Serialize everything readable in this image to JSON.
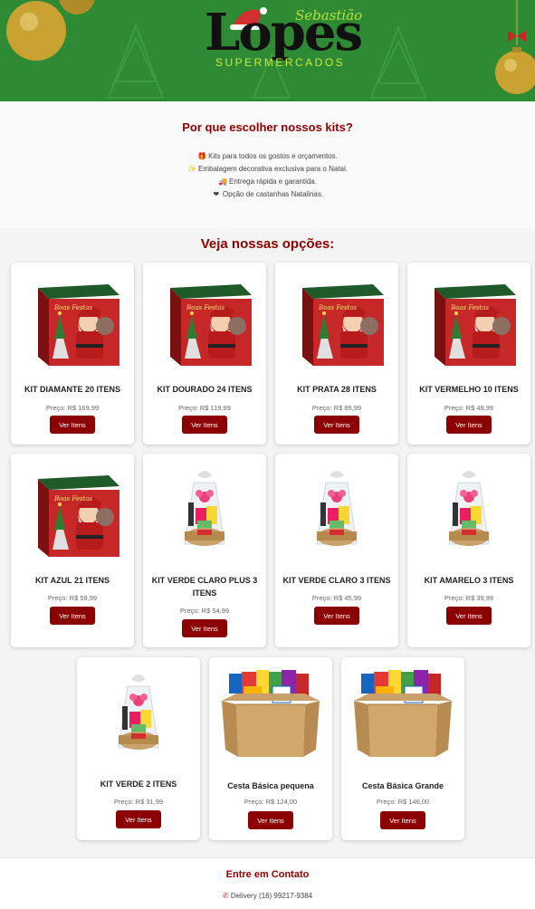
{
  "header": {
    "logo_script": "Sebastião",
    "logo_main": "Lopes",
    "logo_tagline": "SUPERMERCADOS"
  },
  "why": {
    "title": "Por que escolher nossos kits?",
    "items": [
      {
        "icon": "gift-icon",
        "glyph": "🎁",
        "text": "Kits para todos os gostos e orçamentos."
      },
      {
        "icon": "sparkles-icon",
        "glyph": "✨",
        "text": "Embalagem decorativa exclusiva para o Natal."
      },
      {
        "icon": "truck-icon",
        "glyph": "🚚",
        "text": "Entrega rápida e garantida."
      },
      {
        "icon": "heart-icon",
        "glyph": "❤",
        "text": "Opção de castanhas Natalinas."
      }
    ]
  },
  "options_title": "Veja nossas opções:",
  "products": [
    {
      "name": "KIT DIAMANTE 20 ITENS",
      "price": "Preço: R$ 169,99",
      "button": "Ver Itens",
      "image": "santa-box"
    },
    {
      "name": "KIT DOURADO 24 ITENS",
      "price": "Preço: R$ 119,99",
      "button": "Ver Itens",
      "image": "santa-box"
    },
    {
      "name": "KIT PRATA 28 ITENS",
      "price": "Preço: R$ 89,99",
      "button": "Ver Itens",
      "image": "santa-box"
    },
    {
      "name": "KIT VERMELHO 10 ITENS",
      "price": "Preço: R$ 49,99",
      "button": "Ver Itens",
      "image": "santa-box"
    },
    {
      "name": "KIT AZUL 21 ITENS",
      "price": "Preço: R$ 59,99",
      "button": "Ver Itens",
      "image": "santa-box"
    },
    {
      "name": "KIT VERDE CLARO PLUS 3 ITENS",
      "price": "Preço: R$ 54,99",
      "button": "Ver Itens",
      "image": "gift-basket"
    },
    {
      "name": "KIT VERDE CLARO 3 ITENS",
      "price": "Preço: R$ 45,99",
      "button": "Ver Itens",
      "image": "gift-basket"
    },
    {
      "name": "KIT AMARELO 3 ITENS",
      "price": "Preço: R$ 39,99",
      "button": "Ver Itens",
      "image": "gift-basket"
    },
    {
      "name": "KIT VERDE 2 ITENS",
      "price": "Preço: R$ 31,99",
      "button": "Ver Itens",
      "image": "gift-basket"
    },
    {
      "name": "Cesta Básica pequena",
      "price": "Preço: R$ 124,00",
      "button": "Ver Itens",
      "image": "grocery-box"
    },
    {
      "name": "Cesta Básica Grande",
      "price": "Preço: R$ 146,00",
      "button": "Ver Itens",
      "image": "grocery-box"
    }
  ],
  "contact": {
    "title": "Entre em Contato",
    "delivery_icon": "phone-icon",
    "delivery_label": "Delivery",
    "delivery_phone": "(16) 99217-9384"
  },
  "colors": {
    "header_green": "#2e8b34",
    "brand_red": "#8b0000",
    "tagline_lime": "#c8e83c"
  }
}
